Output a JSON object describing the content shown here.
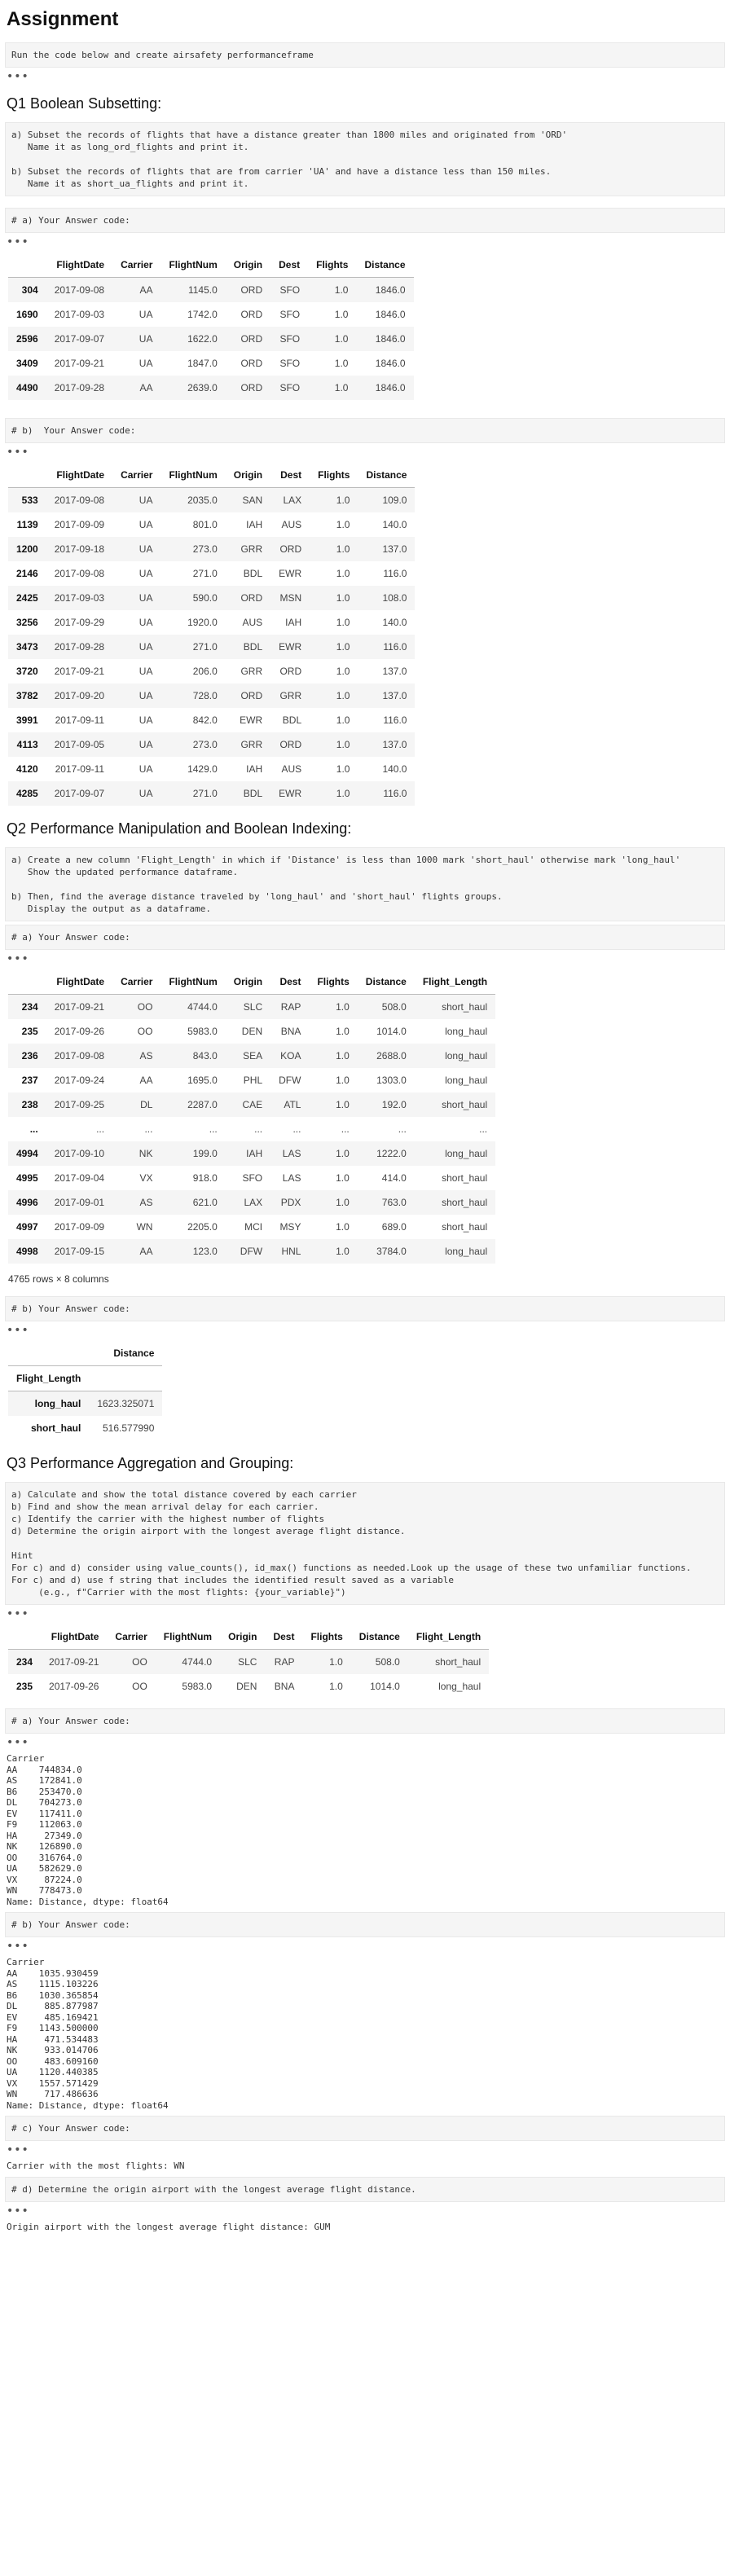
{
  "title": "Assignment",
  "intro": "Run the code below and create airsafety performanceframe",
  "dots": "•••",
  "q1": {
    "heading": "Q1 Boolean Subsetting:",
    "prompt": "a) Subset the records of flights that have a distance greater than 1800 miles and originated from 'ORD'\n   Name it as long_ord_flights and print it.\n\nb) Subset the records of flights that are from carrier 'UA' and have a distance less than 150 miles.\n   Name it as short_ua_flights and print it.",
    "code_a": "# a) Your Answer code:",
    "code_b": "# b)  Your Answer code:",
    "table_a": {
      "columns": [
        "",
        "FlightDate",
        "Carrier",
        "FlightNum",
        "Origin",
        "Dest",
        "Flights",
        "Distance"
      ],
      "rows": [
        [
          "304",
          "2017-09-08",
          "AA",
          "1145.0",
          "ORD",
          "SFO",
          "1.0",
          "1846.0"
        ],
        [
          "1690",
          "2017-09-03",
          "UA",
          "1742.0",
          "ORD",
          "SFO",
          "1.0",
          "1846.0"
        ],
        [
          "2596",
          "2017-09-07",
          "UA",
          "1622.0",
          "ORD",
          "SFO",
          "1.0",
          "1846.0"
        ],
        [
          "3409",
          "2017-09-21",
          "UA",
          "1847.0",
          "ORD",
          "SFO",
          "1.0",
          "1846.0"
        ],
        [
          "4490",
          "2017-09-28",
          "AA",
          "2639.0",
          "ORD",
          "SFO",
          "1.0",
          "1846.0"
        ]
      ]
    },
    "table_b": {
      "columns": [
        "",
        "FlightDate",
        "Carrier",
        "FlightNum",
        "Origin",
        "Dest",
        "Flights",
        "Distance"
      ],
      "rows": [
        [
          "533",
          "2017-09-08",
          "UA",
          "2035.0",
          "SAN",
          "LAX",
          "1.0",
          "109.0"
        ],
        [
          "1139",
          "2017-09-09",
          "UA",
          "801.0",
          "IAH",
          "AUS",
          "1.0",
          "140.0"
        ],
        [
          "1200",
          "2017-09-18",
          "UA",
          "273.0",
          "GRR",
          "ORD",
          "1.0",
          "137.0"
        ],
        [
          "2146",
          "2017-09-08",
          "UA",
          "271.0",
          "BDL",
          "EWR",
          "1.0",
          "116.0"
        ],
        [
          "2425",
          "2017-09-03",
          "UA",
          "590.0",
          "ORD",
          "MSN",
          "1.0",
          "108.0"
        ],
        [
          "3256",
          "2017-09-29",
          "UA",
          "1920.0",
          "AUS",
          "IAH",
          "1.0",
          "140.0"
        ],
        [
          "3473",
          "2017-09-28",
          "UA",
          "271.0",
          "BDL",
          "EWR",
          "1.0",
          "116.0"
        ],
        [
          "3720",
          "2017-09-21",
          "UA",
          "206.0",
          "GRR",
          "ORD",
          "1.0",
          "137.0"
        ],
        [
          "3782",
          "2017-09-20",
          "UA",
          "728.0",
          "ORD",
          "GRR",
          "1.0",
          "137.0"
        ],
        [
          "3991",
          "2017-09-11",
          "UA",
          "842.0",
          "EWR",
          "BDL",
          "1.0",
          "116.0"
        ],
        [
          "4113",
          "2017-09-05",
          "UA",
          "273.0",
          "GRR",
          "ORD",
          "1.0",
          "137.0"
        ],
        [
          "4120",
          "2017-09-11",
          "UA",
          "1429.0",
          "IAH",
          "AUS",
          "1.0",
          "140.0"
        ],
        [
          "4285",
          "2017-09-07",
          "UA",
          "271.0",
          "BDL",
          "EWR",
          "1.0",
          "116.0"
        ]
      ]
    }
  },
  "q2": {
    "heading": "Q2 Performance Manipulation and Boolean Indexing:",
    "prompt": "a) Create a new column 'Flight_Length' in which if 'Distance' is less than 1000 mark 'short_haul' otherwise mark 'long_haul'\n   Show the updated performance dataframe.\n\nb) Then, find the average distance traveled by 'long_haul' and 'short_haul' flights groups.\n   Display the output as a dataframe.",
    "code_a": "# a) Your Answer code:",
    "code_b": "# b) Your Answer code:",
    "table_a": {
      "columns": [
        "",
        "FlightDate",
        "Carrier",
        "FlightNum",
        "Origin",
        "Dest",
        "Flights",
        "Distance",
        "Flight_Length"
      ],
      "rows": [
        [
          "234",
          "2017-09-21",
          "OO",
          "4744.0",
          "SLC",
          "RAP",
          "1.0",
          "508.0",
          "short_haul"
        ],
        [
          "235",
          "2017-09-26",
          "OO",
          "5983.0",
          "DEN",
          "BNA",
          "1.0",
          "1014.0",
          "long_haul"
        ],
        [
          "236",
          "2017-09-08",
          "AS",
          "843.0",
          "SEA",
          "KOA",
          "1.0",
          "2688.0",
          "long_haul"
        ],
        [
          "237",
          "2017-09-24",
          "AA",
          "1695.0",
          "PHL",
          "DFW",
          "1.0",
          "1303.0",
          "long_haul"
        ],
        [
          "238",
          "2017-09-25",
          "DL",
          "2287.0",
          "CAE",
          "ATL",
          "1.0",
          "192.0",
          "short_haul"
        ],
        [
          "...",
          "...",
          "...",
          "...",
          "...",
          "...",
          "...",
          "...",
          "..."
        ],
        [
          "4994",
          "2017-09-10",
          "NK",
          "199.0",
          "IAH",
          "LAS",
          "1.0",
          "1222.0",
          "long_haul"
        ],
        [
          "4995",
          "2017-09-04",
          "VX",
          "918.0",
          "SFO",
          "LAS",
          "1.0",
          "414.0",
          "short_haul"
        ],
        [
          "4996",
          "2017-09-01",
          "AS",
          "621.0",
          "LAX",
          "PDX",
          "1.0",
          "763.0",
          "short_haul"
        ],
        [
          "4997",
          "2017-09-09",
          "WN",
          "2205.0",
          "MCI",
          "MSY",
          "1.0",
          "689.0",
          "short_haul"
        ],
        [
          "4998",
          "2017-09-15",
          "AA",
          "123.0",
          "DFW",
          "HNL",
          "1.0",
          "3784.0",
          "long_haul"
        ]
      ]
    },
    "shape": "4765 rows × 8 columns",
    "table_b": {
      "col": "Distance",
      "index_name": "Flight_Length",
      "rows": [
        [
          "long_haul",
          "1623.325071"
        ],
        [
          "short_haul",
          "516.577990"
        ]
      ]
    }
  },
  "q3": {
    "heading": "Q3 Performance Aggregation and Grouping:",
    "prompt": "a) Calculate and show the total distance covered by each carrier\nb) Find and show the mean arrival delay for each carrier.\nc) Identify the carrier with the highest number of flights\nd) Determine the origin airport with the longest average flight distance.\n\nHint\nFor c) and d) consider using value_counts(), id_max() functions as needed.Look up the usage of these two unfamiliar functions.\nFor c) and d) use f string that includes the identified result saved as a variable\n     (e.g., f\"Carrier with the most flights: {your_variable}\")",
    "table": {
      "columns": [
        "",
        "FlightDate",
        "Carrier",
        "FlightNum",
        "Origin",
        "Dest",
        "Flights",
        "Distance",
        "Flight_Length"
      ],
      "rows": [
        [
          "234",
          "2017-09-21",
          "OO",
          "4744.0",
          "SLC",
          "RAP",
          "1.0",
          "508.0",
          "short_haul"
        ],
        [
          "235",
          "2017-09-26",
          "OO",
          "5983.0",
          "DEN",
          "BNA",
          "1.0",
          "1014.0",
          "long_haul"
        ]
      ]
    },
    "code_a": "# a) Your Answer code:",
    "out_a": "Carrier\nAA    744834.0\nAS    172841.0\nB6    253470.0\nDL    704273.0\nEV    117411.0\nF9    112063.0\nHA     27349.0\nNK    126890.0\nOO    316764.0\nUA    582629.0\nVX     87224.0\nWN    778473.0\nName: Distance, dtype: float64",
    "code_b": "# b) Your Answer code:",
    "out_b": "Carrier\nAA    1035.930459\nAS    1115.103226\nB6    1030.365854\nDL     885.877987\nEV     485.169421\nF9    1143.500000\nHA     471.534483\nNK     933.014706\nOO     483.609160\nUA    1120.440385\nVX    1557.571429\nWN     717.486636\nName: Distance, dtype: float64",
    "code_c": "# c) Your Answer code:",
    "out_c": "Carrier with the most flights: WN",
    "code_d": "# d) Determine the origin airport with the longest average flight distance.",
    "out_d": "Origin airport with the longest average flight distance: GUM"
  }
}
